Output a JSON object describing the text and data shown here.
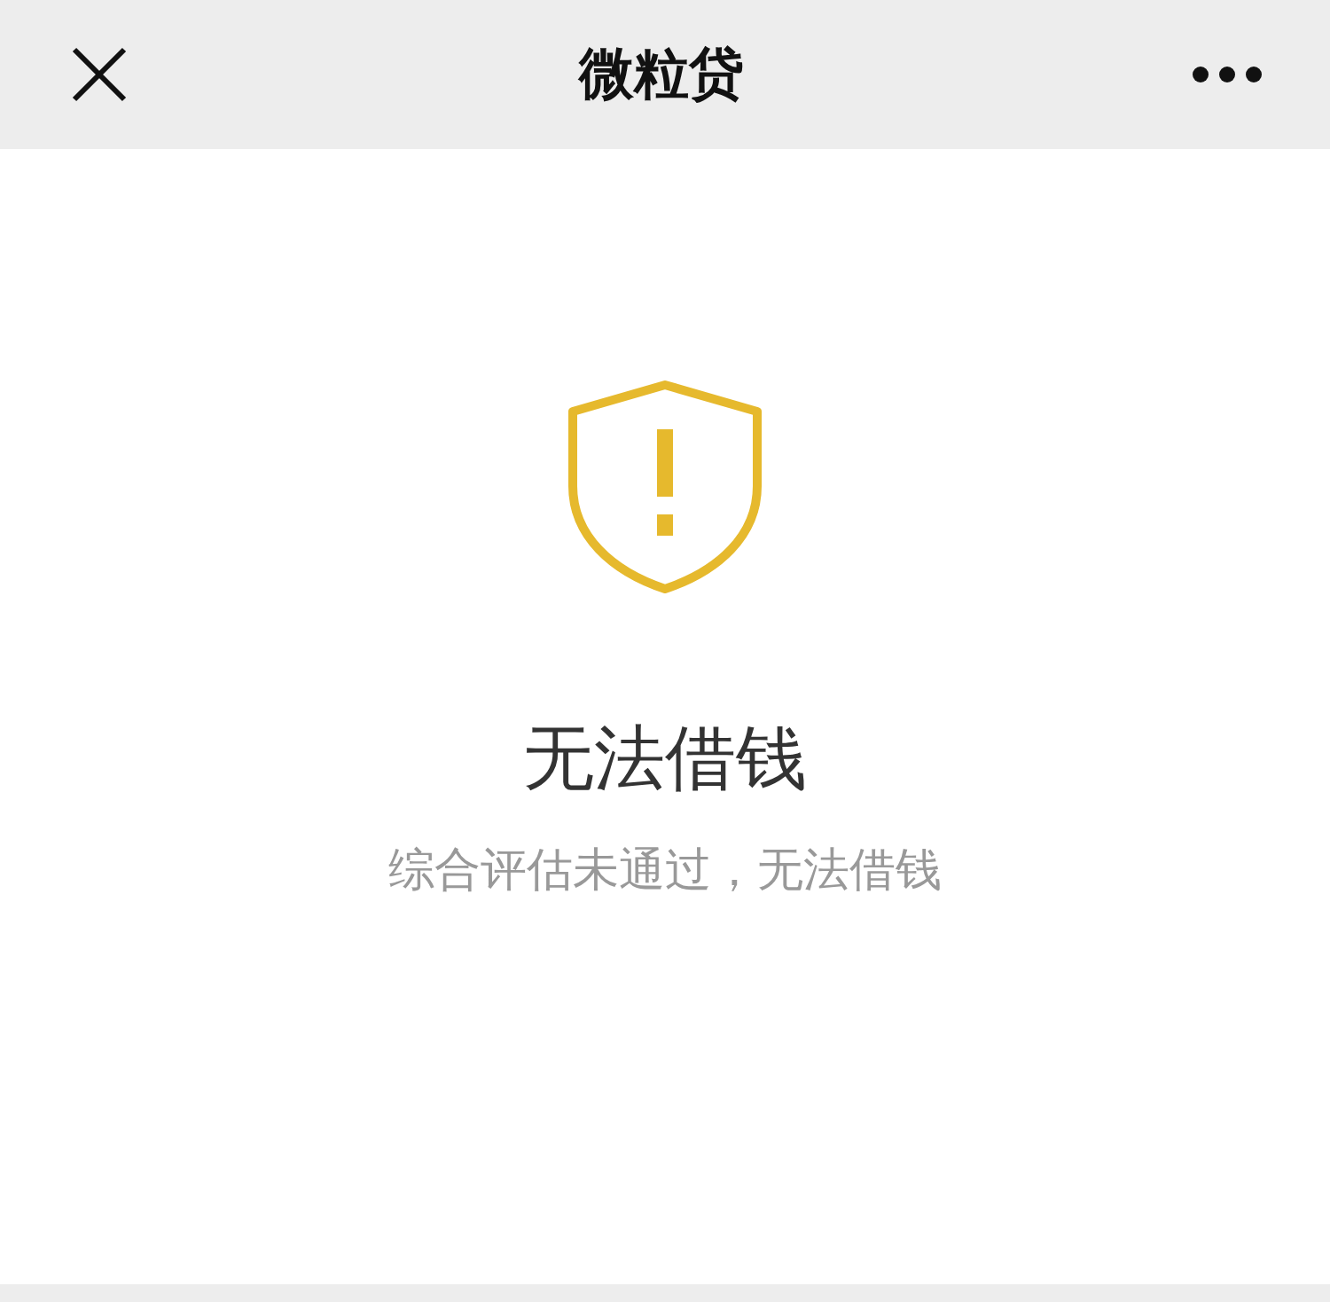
{
  "header": {
    "title": "微粒贷"
  },
  "result": {
    "title": "无法借钱",
    "message": "综合评估未通过，无法借钱"
  }
}
